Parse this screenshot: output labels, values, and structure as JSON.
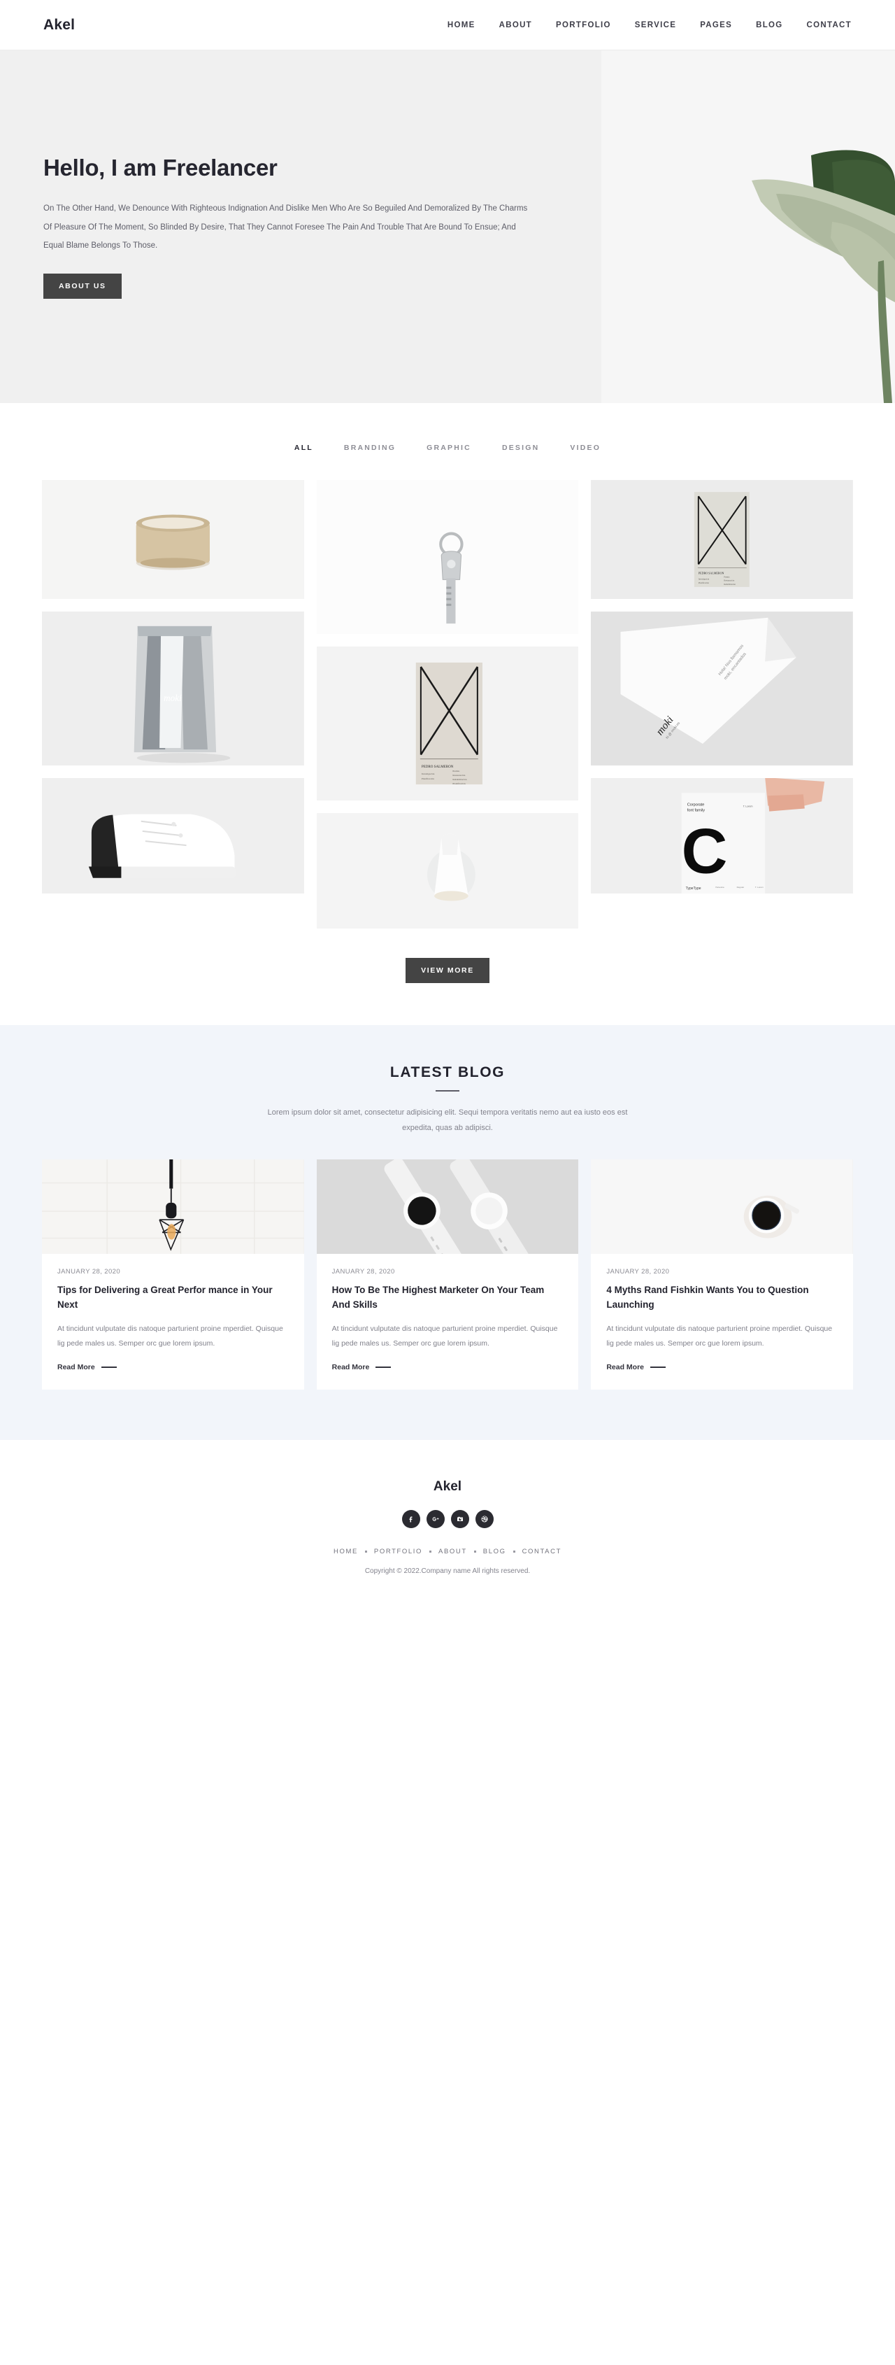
{
  "header": {
    "brand": "Akel",
    "nav": [
      {
        "label": "HOME"
      },
      {
        "label": "ABOUT"
      },
      {
        "label": "PORTFOLIO"
      },
      {
        "label": "SERVICE"
      },
      {
        "label": "PAGES"
      },
      {
        "label": "BLOG"
      },
      {
        "label": "CONTACT"
      }
    ]
  },
  "hero": {
    "title": "Hello, I am Freelancer",
    "text": "On The Other Hand, We Denounce With Righteous Indignation And Dislike Men Who Are So Beguiled And Demoralized By The Charms Of Pleasure Of The Moment, So Blinded By Desire, That They Cannot Foresee The Pain And Trouble That Are Bound To Ensue; And Equal Blame Belongs To Those.",
    "cta": "ABOUT US",
    "photo_alt": "monstera-leaf-photo"
  },
  "portfolio": {
    "filters": [
      {
        "label": "ALL",
        "active": true
      },
      {
        "label": "BRANDING",
        "active": false
      },
      {
        "label": "GRAPHIC",
        "active": false
      },
      {
        "label": "DESIGN",
        "active": false
      },
      {
        "label": "VIDEO",
        "active": false
      }
    ],
    "items": [
      {
        "name": "beige-ceramic-cup"
      },
      {
        "name": "silver-key-keyring"
      },
      {
        "name": "pedro-salmeron-box-packaging"
      },
      {
        "name": "moki-silver-foil-pouch"
      },
      {
        "name": "pedro-salmeron-box-front"
      },
      {
        "name": "moki-folded-stationery"
      },
      {
        "name": "black-white-sneaker"
      },
      {
        "name": "white-pendant-lamp-shade"
      },
      {
        "name": "corporate-font-family-poster"
      }
    ],
    "view_more": "VIEW MORE"
  },
  "blog": {
    "title": "LATEST BLOG",
    "subtitle": "Lorem ipsum dolor sit amet, consectetur adipisicing elit. Sequi tempora veritatis nemo aut ea iusto eos est expedita, quas ab adipisci.",
    "read_more": "Read More",
    "posts": [
      {
        "date": "JANUARY 28, 2020",
        "title": "Tips for Delivering a Great Perfor mance in Your Next",
        "excerpt": "At tincidunt vulputate dis natoque parturient proine mperdiet. Quisque lig pede males us. Semper orc gue lorem ipsum.",
        "image": "pendant-lamp-photo",
        "read_more": "Read More"
      },
      {
        "date": "JANUARY 28, 2020",
        "title": "How To Be The Highest Marketer On Your Team And Skills",
        "excerpt": "At tincidunt vulputate dis natoque parturient proine mperdiet. Quisque lig pede males us. Semper orc gue lorem ipsum.",
        "image": "two-wristwatches-photo",
        "read_more": "Read More"
      },
      {
        "date": "JANUARY 28, 2020",
        "title": "4 Myths Rand Fishkin Wants You to Question Launching",
        "excerpt": "At tincidunt vulputate dis natoque parturient proine mperdiet. Quisque lig pede males us. Semper orc gue lorem ipsum.",
        "image": "black-coffee-cup-photo",
        "read_more": "Read More"
      }
    ]
  },
  "footer": {
    "brand": "Akel",
    "socials": [
      {
        "name": "facebook"
      },
      {
        "name": "google-plus"
      },
      {
        "name": "instagram"
      },
      {
        "name": "dribbble"
      }
    ],
    "nav": [
      {
        "label": "HOME"
      },
      {
        "label": "PORTFOLIO"
      },
      {
        "label": "ABOUT"
      },
      {
        "label": "BLOG"
      },
      {
        "label": "CONTACT"
      }
    ],
    "copyright": "Copyright © 2022.Company name All rights reserved."
  },
  "colors": {
    "accent_dark": "#444444",
    "text_dark": "#23232e",
    "text_muted": "#81818b",
    "hero_bg": "#f0f0f0",
    "blog_bg": "#f2f5fa"
  }
}
